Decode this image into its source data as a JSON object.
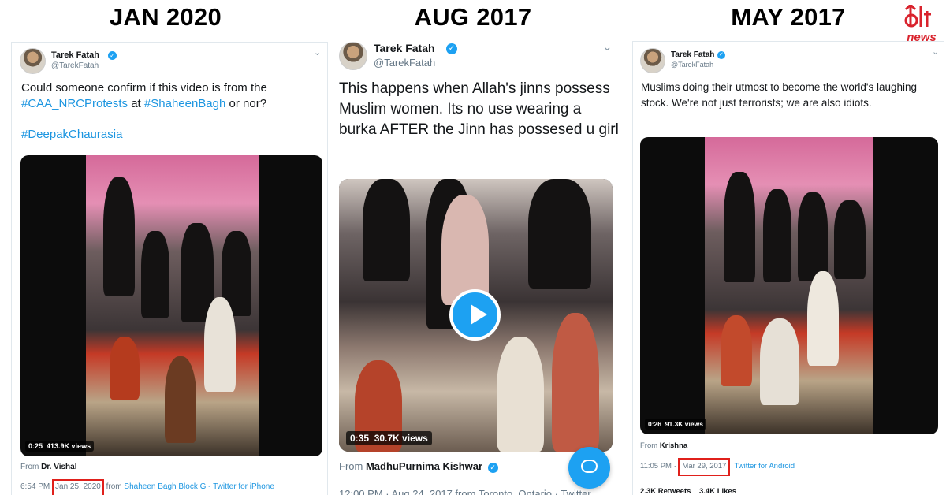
{
  "headings": [
    "JAN 2020",
    "AUG 2017",
    "MAY 2017"
  ],
  "logo": {
    "mark": "alt",
    "sub": "news",
    "accent": "#d9232d"
  },
  "colors": {
    "twitter_blue": "#1da1f2",
    "hashtag": "#1b95e0",
    "highlight_box": "#e0201b"
  },
  "tweets": [
    {
      "name": "Tarek Fatah",
      "handle": "@TarekFatah",
      "text_line1": "Could someone confirm if this video is from the",
      "hashtag1": "#CAA_NRCProtests",
      "at_word": " at ",
      "hashtag2": "#ShaheenBagh",
      "tail": " or nor?",
      "hashtag3": "#DeepakChaurasia",
      "video_duration": "0:25",
      "video_views": "413.9K views",
      "from_prefix": "From ",
      "from_user": "Dr. Vishal",
      "time": "6:54 PM",
      "date": "Jan 25, 2020",
      "from_word": " from ",
      "source": "Shaheen Bagh Block G - Twitter for iPhone"
    },
    {
      "name": "Tarek Fatah",
      "handle": "@TarekFatah",
      "text": "This happens when Allah's jinns possess Muslim women. Its no use wearing a burka AFTER the Jinn has possesed u girl",
      "video_duration": "0:35",
      "video_views": "30.7K views",
      "from_prefix": "From ",
      "from_user": "MadhuPurnima Kishwar",
      "meta_partial": "12:00 PM · Aug 24, 2017 from Toronto, Ontario · Twitter"
    },
    {
      "name": "Tarek Fatah",
      "handle": "@TarekFatah",
      "text": "Muslims doing their utmost to become the world's laughing stock. We're not just terrorists; we are also idiots.",
      "video_duration": "0:26",
      "video_views": "91.3K views",
      "from_prefix": "From ",
      "from_user": "Krishna",
      "time": "11:05 PM",
      "date": "Mar 29, 2017",
      "source": "Twitter for Android",
      "retweets": "2.3K Retweets",
      "likes": "3.4K Likes"
    }
  ]
}
